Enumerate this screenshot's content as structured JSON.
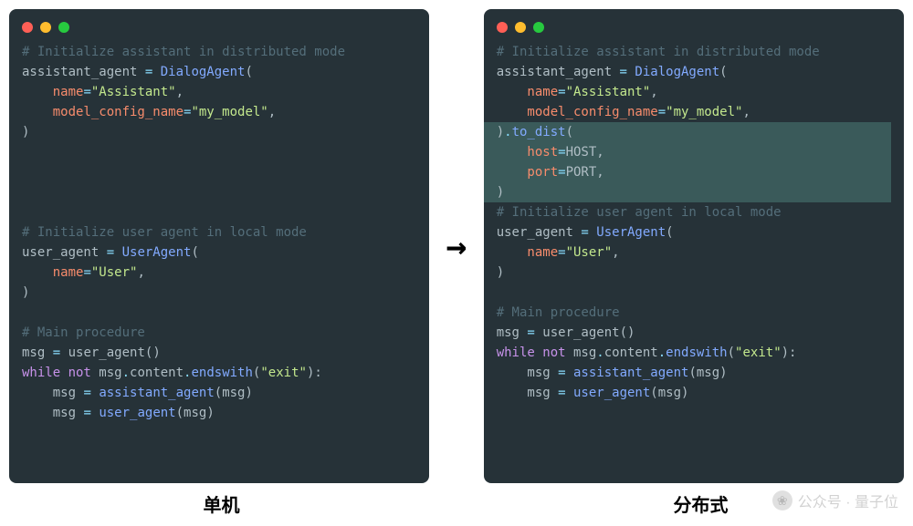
{
  "panels": {
    "left": {
      "label": "单机",
      "lines": [
        {
          "kind": "comment",
          "text": "# Initialize assistant in distributed mode"
        },
        {
          "kind": "assign_call",
          "lhs": "assistant_agent",
          "func": "DialogAgent",
          "open": "("
        },
        {
          "kind": "kwarg",
          "indent": 1,
          "name": "name",
          "value": "\"Assistant\"",
          "vtype": "str",
          "comma": true
        },
        {
          "kind": "kwarg",
          "indent": 1,
          "name": "model_config_name",
          "value": "\"my_model\"",
          "vtype": "str",
          "comma": true
        },
        {
          "kind": "close",
          "text": ")"
        },
        {
          "kind": "blank"
        },
        {
          "kind": "blank"
        },
        {
          "kind": "blank"
        },
        {
          "kind": "blank"
        },
        {
          "kind": "comment",
          "text": "# Initialize user agent in local mode"
        },
        {
          "kind": "assign_call",
          "lhs": "user_agent",
          "func": "UserAgent",
          "open": "("
        },
        {
          "kind": "kwarg",
          "indent": 1,
          "name": "name",
          "value": "\"User\"",
          "vtype": "str",
          "comma": true
        },
        {
          "kind": "close",
          "text": ")"
        },
        {
          "kind": "blank"
        },
        {
          "kind": "comment",
          "text": "# Main procedure"
        },
        {
          "kind": "assign_callexpr",
          "lhs": "msg",
          "expr": [
            {
              "t": "ident",
              "v": "user_agent"
            },
            {
              "t": "punc",
              "v": "()"
            }
          ]
        },
        {
          "kind": "while",
          "expr": [
            {
              "t": "kw",
              "v": "while "
            },
            {
              "t": "kw",
              "v": "not "
            },
            {
              "t": "ident",
              "v": "msg"
            },
            {
              "t": "op",
              "v": "."
            },
            {
              "t": "ident",
              "v": "content"
            },
            {
              "t": "op",
              "v": "."
            },
            {
              "t": "func",
              "v": "endswith"
            },
            {
              "t": "punc",
              "v": "("
            },
            {
              "t": "str",
              "v": "\"exit\""
            },
            {
              "t": "punc",
              "v": "):"
            }
          ]
        },
        {
          "kind": "stmt",
          "indent": 1,
          "expr": [
            {
              "t": "ident",
              "v": "msg"
            },
            {
              "t": "op",
              "v": " = "
            },
            {
              "t": "func",
              "v": "assistant_agent"
            },
            {
              "t": "punc",
              "v": "("
            },
            {
              "t": "ident",
              "v": "msg"
            },
            {
              "t": "punc",
              "v": ")"
            }
          ]
        },
        {
          "kind": "stmt",
          "indent": 1,
          "expr": [
            {
              "t": "ident",
              "v": "msg"
            },
            {
              "t": "op",
              "v": " = "
            },
            {
              "t": "func",
              "v": "user_agent"
            },
            {
              "t": "punc",
              "v": "("
            },
            {
              "t": "ident",
              "v": "msg"
            },
            {
              "t": "punc",
              "v": ")"
            }
          ]
        }
      ]
    },
    "right": {
      "label": "分布式",
      "lines": [
        {
          "kind": "comment",
          "text": "# Initialize assistant in distributed mode"
        },
        {
          "kind": "assign_call",
          "lhs": "assistant_agent",
          "func": "DialogAgent",
          "open": "("
        },
        {
          "kind": "kwarg",
          "indent": 1,
          "name": "name",
          "value": "\"Assistant\"",
          "vtype": "str",
          "comma": true
        },
        {
          "kind": "kwarg",
          "indent": 1,
          "name": "model_config_name",
          "value": "\"my_model\"",
          "vtype": "str",
          "comma": true
        },
        {
          "kind": "chain",
          "hl": true,
          "expr": [
            {
              "t": "punc",
              "v": ")"
            },
            {
              "t": "op",
              "v": "."
            },
            {
              "t": "func",
              "v": "to_dist"
            },
            {
              "t": "punc",
              "v": "("
            }
          ]
        },
        {
          "kind": "kwarg",
          "hl": true,
          "indent": 1,
          "name": "host",
          "value": "HOST",
          "vtype": "const",
          "comma": true
        },
        {
          "kind": "kwarg",
          "hl": true,
          "indent": 1,
          "name": "port",
          "value": "PORT",
          "vtype": "const",
          "comma": true
        },
        {
          "kind": "close",
          "hl": true,
          "text": ")"
        },
        {
          "kind": "comment",
          "text": "# Initialize user agent in local mode"
        },
        {
          "kind": "assign_call",
          "lhs": "user_agent",
          "func": "UserAgent",
          "open": "("
        },
        {
          "kind": "kwarg",
          "indent": 1,
          "name": "name",
          "value": "\"User\"",
          "vtype": "str",
          "comma": true
        },
        {
          "kind": "close",
          "text": ")"
        },
        {
          "kind": "blank"
        },
        {
          "kind": "comment",
          "text": "# Main procedure"
        },
        {
          "kind": "assign_callexpr",
          "lhs": "msg",
          "expr": [
            {
              "t": "ident",
              "v": "user_agent"
            },
            {
              "t": "punc",
              "v": "()"
            }
          ]
        },
        {
          "kind": "while",
          "expr": [
            {
              "t": "kw",
              "v": "while "
            },
            {
              "t": "kw",
              "v": "not "
            },
            {
              "t": "ident",
              "v": "msg"
            },
            {
              "t": "op",
              "v": "."
            },
            {
              "t": "ident",
              "v": "content"
            },
            {
              "t": "op",
              "v": "."
            },
            {
              "t": "func",
              "v": "endswith"
            },
            {
              "t": "punc",
              "v": "("
            },
            {
              "t": "str",
              "v": "\"exit\""
            },
            {
              "t": "punc",
              "v": "):"
            }
          ]
        },
        {
          "kind": "stmt",
          "indent": 1,
          "expr": [
            {
              "t": "ident",
              "v": "msg"
            },
            {
              "t": "op",
              "v": " = "
            },
            {
              "t": "func",
              "v": "assistant_agent"
            },
            {
              "t": "punc",
              "v": "("
            },
            {
              "t": "ident",
              "v": "msg"
            },
            {
              "t": "punc",
              "v": ")"
            }
          ]
        },
        {
          "kind": "stmt",
          "indent": 1,
          "expr": [
            {
              "t": "ident",
              "v": "msg"
            },
            {
              "t": "op",
              "v": " = "
            },
            {
              "t": "func",
              "v": "user_agent"
            },
            {
              "t": "punc",
              "v": "("
            },
            {
              "t": "ident",
              "v": "msg"
            },
            {
              "t": "punc",
              "v": ")"
            }
          ]
        }
      ]
    }
  },
  "arrow": "→",
  "watermark": {
    "prefix": "公众号 · ",
    "name": "量子位"
  }
}
